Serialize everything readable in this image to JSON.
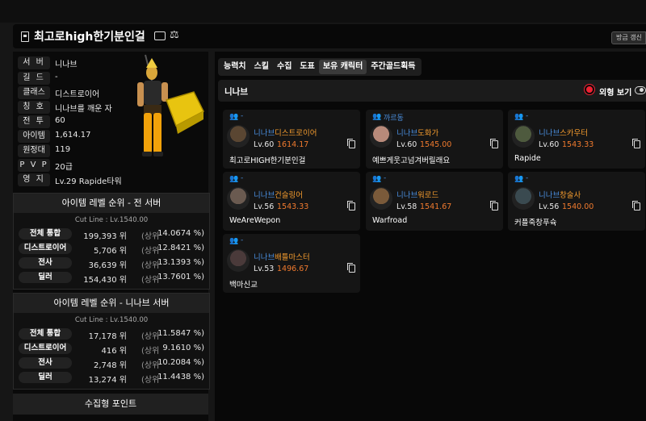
{
  "header": {
    "character_name": "최고로high한기분인걸",
    "refresh_label": "방금 갱신"
  },
  "profile": {
    "rows": [
      {
        "label": "서 버",
        "value": "니나브"
      },
      {
        "label": "길 드",
        "value": "-"
      },
      {
        "label": "클래스",
        "value": "디스트로이어"
      },
      {
        "label": "칭 호",
        "value": "니나브를 깨운 자"
      },
      {
        "label": "전 투",
        "value": "60"
      },
      {
        "label": "아이템",
        "value": "1,614.17"
      },
      {
        "label": "원정대",
        "value": "119"
      },
      {
        "label": "P V P",
        "value": "20급"
      },
      {
        "label": "영 지",
        "value": "Lv.29 Rapide타워"
      }
    ]
  },
  "rank_all": {
    "title": "아이템 레벨 순위 - 전 서버",
    "cutline": "Cut Line : Lv.1540.00",
    "rows": [
      {
        "label": "전체 통합",
        "rank": "199,393 위",
        "sub": "(상위",
        "pct": "14.0674 %)"
      },
      {
        "label": "디스트로이어",
        "rank": "5,706 위",
        "sub": "(상위",
        "pct": "12.8421 %)"
      },
      {
        "label": "전사",
        "rank": "36,639 위",
        "sub": "(상위",
        "pct": "13.1393 %)"
      },
      {
        "label": "딜러",
        "rank": "154,430 위",
        "sub": "(상위",
        "pct": "13.7601 %)"
      }
    ]
  },
  "rank_server": {
    "title": "아이템 레벨 순위 - 니나브 서버",
    "cutline": "Cut Line : Lv.1540.00",
    "rows": [
      {
        "label": "전체 통합",
        "rank": "17,178 위",
        "sub": "(상위",
        "pct": "11.5847 %)"
      },
      {
        "label": "디스트로이어",
        "rank": "416 위",
        "sub": "(상위",
        "pct": "9.1610 %)"
      },
      {
        "label": "전사",
        "rank": "2,748 위",
        "sub": "(상위",
        "pct": "10.2084 %)"
      },
      {
        "label": "딜러",
        "rank": "13,274 위",
        "sub": "(상위",
        "pct": "11.4438 %)"
      }
    ]
  },
  "collect": {
    "title": "수집형 포인트"
  },
  "tabs": [
    "능력치",
    "스킬",
    "수집",
    "도표",
    "보유 캐릭터",
    "주간골드획득"
  ],
  "active_tab": "보유 캐릭터",
  "server_section": {
    "name": "니나브",
    "look_label": "외형 보기"
  },
  "characters": [
    {
      "group": "-",
      "server": "니나브",
      "class": "디스트로이어",
      "level": "Lv.60",
      "item_level": "1614.17",
      "nickname": "최고로HIGH한기분인걸"
    },
    {
      "group": "까르동",
      "server": "니나브",
      "class": "도화가",
      "level": "Lv.60",
      "item_level": "1545.00",
      "nickname": "예쁘게웃고넘겨버릴래요"
    },
    {
      "group": "-",
      "server": "니나브",
      "class": "스카우터",
      "level": "Lv.60",
      "item_level": "1543.33",
      "nickname": "Rapide"
    },
    {
      "group": "-",
      "server": "니나브",
      "class": "건슬링어",
      "level": "Lv.56",
      "item_level": "1543.33",
      "nickname": "WeAreWepon"
    },
    {
      "group": "-",
      "server": "니나브",
      "class": "워로드",
      "level": "Lv.58",
      "item_level": "1541.67",
      "nickname": "Warfroad"
    },
    {
      "group": "-",
      "server": "니나브",
      "class": "창술사",
      "level": "Lv.56",
      "item_level": "1540.00",
      "nickname": "커플죽창푸슉"
    },
    {
      "group": "-",
      "server": "니나브",
      "class": "배틀마스터",
      "level": "Lv.53",
      "item_level": "1496.67",
      "nickname": "백마신교"
    }
  ],
  "colors": {
    "server_blue": "#4a8fe0",
    "class_orange": "#f29a2e",
    "item_level_orange": "#f07a2e",
    "look_dot_red": "#ee2233"
  }
}
